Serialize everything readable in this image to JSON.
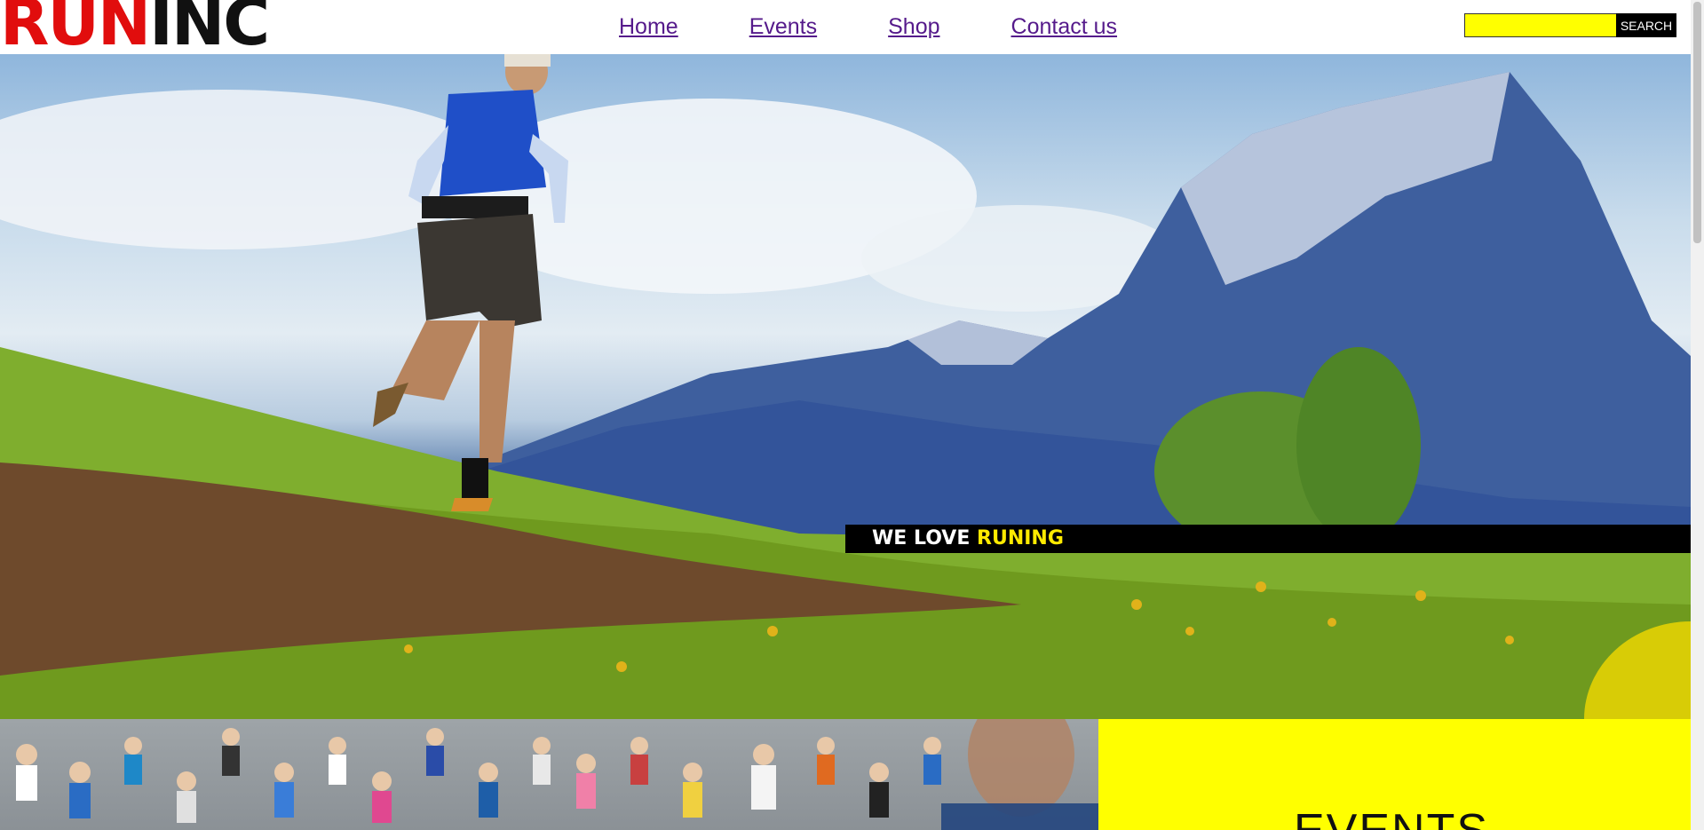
{
  "header": {
    "logo_part1": "RUN",
    "logo_part2": "INC",
    "nav": [
      {
        "label": "Home"
      },
      {
        "label": "Events"
      },
      {
        "label": "Shop"
      },
      {
        "label": "Contact us"
      }
    ],
    "search": {
      "value": "",
      "placeholder": "",
      "button_label": "SEARCH"
    }
  },
  "hero": {
    "banner_text": "WE LOVE ",
    "banner_accent": "RUNING"
  },
  "events": {
    "title": "EVENTS"
  },
  "colors": {
    "brand_red": "#e10d0d",
    "accent_yellow": "#ffff00",
    "banner_bg": "#000000",
    "link": "#551a8b"
  }
}
